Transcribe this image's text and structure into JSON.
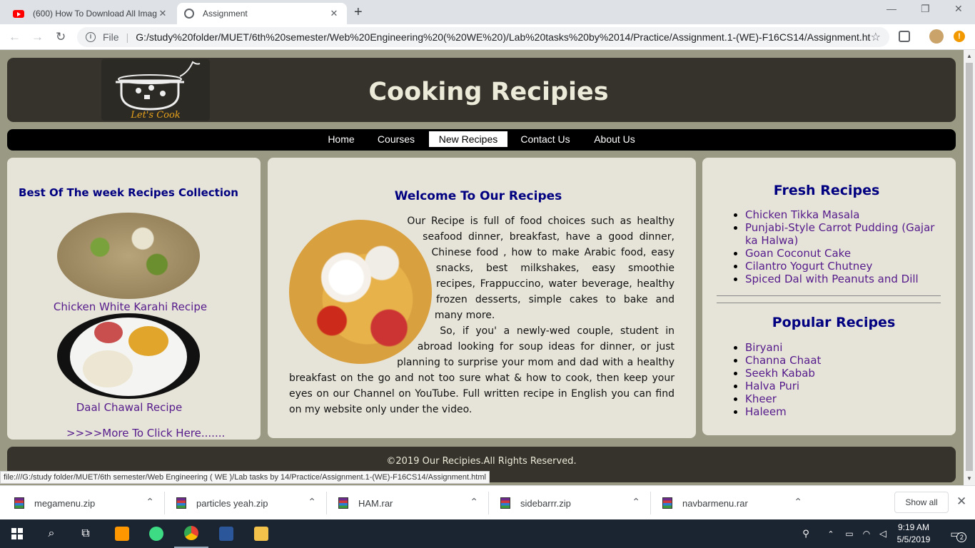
{
  "browser": {
    "tabs": [
      {
        "title": "(600) How To Download All Imag",
        "active": false
      },
      {
        "title": "Assignment",
        "active": true
      }
    ],
    "new_tab": "+",
    "window_controls": {
      "minimize": "—",
      "restore": "❐",
      "close": "✕"
    },
    "nav": {
      "back": "←",
      "forward": "→",
      "reload": "↻"
    },
    "address": {
      "scheme_label": "File",
      "url": "G:/study%20folder/MUET/6th%20semester/Web%20Engineering%20(%20WE%20)/Lab%20tasks%20by%2014/Practice/Assignment.1-(WE)-F16CS14/Assignment.html"
    },
    "status_url": "file:///G:/study folder/MUET/6th semester/Web Engineering ( WE )/Lab tasks by 14/Practice/Assignment.1-(WE)-F16CS14/Assignment.html"
  },
  "site": {
    "logo_text": "Let's Cook",
    "title": "Cooking Recipies",
    "nav": [
      {
        "label": "Home",
        "active": false
      },
      {
        "label": "Courses",
        "active": false
      },
      {
        "label": "New Recipes",
        "active": true
      },
      {
        "label": "Contact Us",
        "active": false
      },
      {
        "label": "About Us",
        "active": false
      }
    ]
  },
  "left_panel": {
    "heading": "Best Of The week Recipes Collection",
    "items": [
      {
        "caption": "Chicken White Karahi Recipe"
      },
      {
        "caption": "Daal Chawal Recipe"
      }
    ],
    "more_link": ">>>>More To Click Here......."
  },
  "center_panel": {
    "heading": "Welcome To Our Recipes",
    "paragraph_1": "Our Recipe is full of food choices such as healthy seafood dinner, breakfast, have a good dinner, Chinese food , how to make Arabic food, easy snacks, best milkshakes, easy smoothie recipes, Frappuccino, water beverage, healthy frozen desserts, simple cakes to bake and many more.",
    "paragraph_2": "So, if you' a newly-wed couple, student in abroad looking for soup ideas for dinner, or just planning to surprise your mom and dad with a healthy breakfast on the go and not too sure what & how to cook, then keep your eyes on our Channel on YouTube. Full written recipe in English you can find on my website only under the video."
  },
  "right_panel": {
    "fresh_heading": "Fresh Recipes",
    "fresh": [
      "Chicken Tikka Masala",
      "Punjabi-Style Carrot Pudding (Gajar ka Halwa)",
      "Goan Coconut Cake",
      "Cilantro Yogurt Chutney",
      "Spiced Dal with Peanuts and Dill"
    ],
    "popular_heading": "Popular Recipes",
    "popular": [
      "Biryani",
      "Channa Chaat",
      "Seekh Kabab",
      "Halva Puri",
      "Kheer",
      "Haleem"
    ]
  },
  "footer": {
    "text": "©2019 Our Recipies.All Rights Reserved."
  },
  "downloads": {
    "items": [
      "megamenu.zip",
      "particles yeah.zip",
      "HAM.rar",
      "sidebarrr.zip",
      "navbarmenu.rar"
    ],
    "show_all": "Show all"
  },
  "taskbar": {
    "time": "9:19 AM",
    "date": "5/5/2019",
    "notification_count": "2"
  },
  "colors": {
    "header_bg": "#35332c",
    "panel_bg": "#e6e4d8",
    "page_bg": "#9a9a84",
    "heading": "#000080",
    "link": "#551a8b"
  }
}
